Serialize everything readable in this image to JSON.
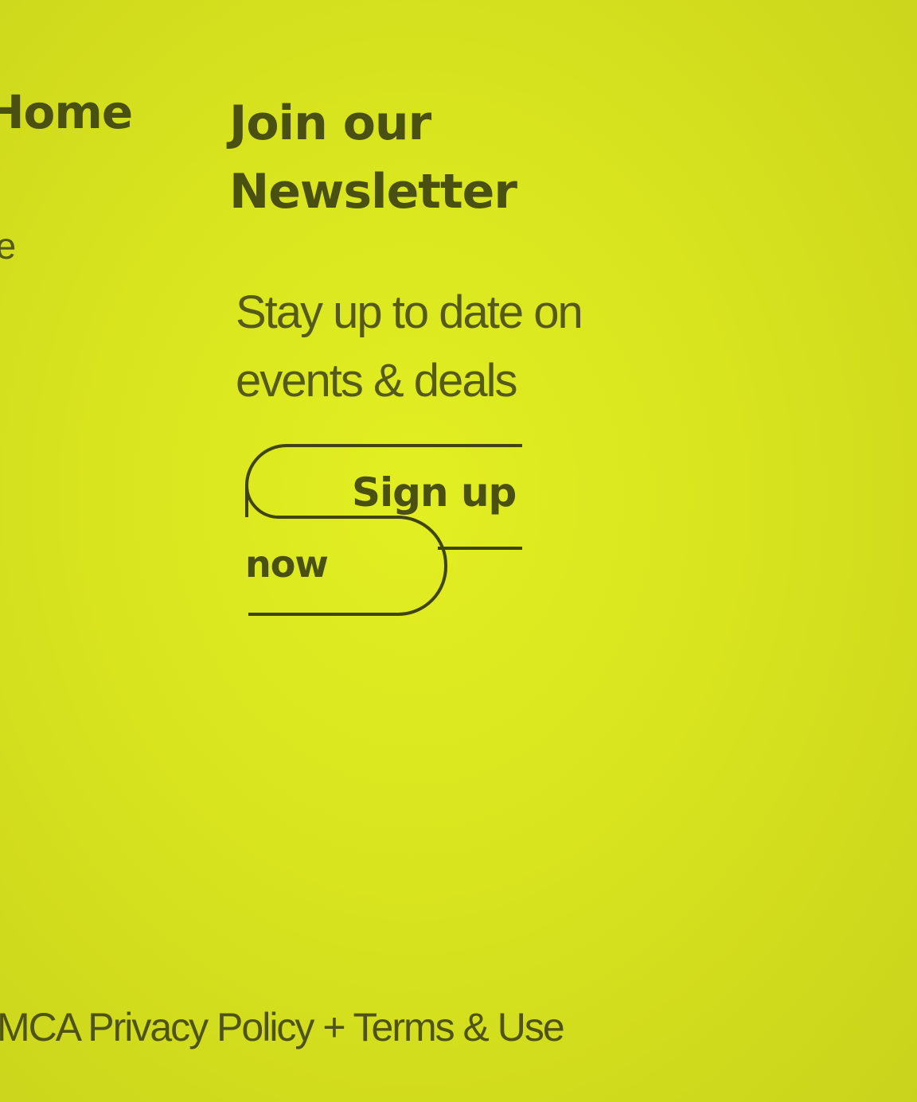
{
  "nav": {
    "heading": "Home",
    "link_1": "nce",
    "link_2": "e"
  },
  "newsletter": {
    "title_line1": "Join our",
    "title_line2": "Newsletter",
    "text_line1": "Stay up to date on",
    "text_line2": "events & deals",
    "button_line1": "Sign up",
    "button_line2": "now"
  },
  "footer": {
    "privacy_link": "MCA Privacy Policy",
    "separator": "+",
    "terms_link": "Terms & Use"
  },
  "colors": {
    "background": "#dfeb21",
    "text": "#4a4f12",
    "outline": "#3f4410"
  }
}
